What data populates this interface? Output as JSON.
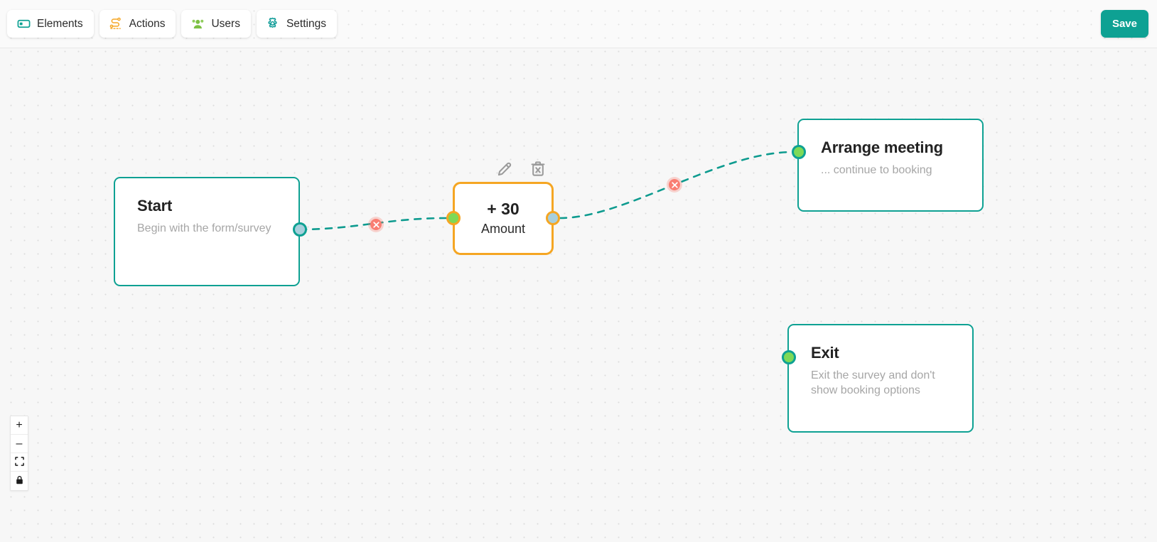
{
  "toolbar": {
    "buttons": [
      {
        "label": "Elements",
        "icon": "elements-icon",
        "color": "#0ea193"
      },
      {
        "label": "Actions",
        "icon": "actions-flow-icon",
        "color": "#f5a623"
      },
      {
        "label": "Users",
        "icon": "users-group-icon",
        "color": "#7cc043"
      },
      {
        "label": "Settings",
        "icon": "gear-icon",
        "color": "#0e9b97"
      }
    ],
    "save_label": "Save",
    "save_color": "#0ea193"
  },
  "canvas": {
    "background_color": "#f7f7f7",
    "dot_color": "#dcdcdc",
    "edge_color": "#0e9b8f",
    "edge_style": "dashed"
  },
  "nodes": [
    {
      "id": "start",
      "title": "Start",
      "description": "Begin with the form/survey",
      "border_color": "#0ea193",
      "selected": false
    },
    {
      "id": "amount",
      "title": "+ 30",
      "description": "Amount",
      "border_color": "#f5a623",
      "selected": true
    },
    {
      "id": "meeting",
      "title": "Arrange meeting",
      "description": "... continue to booking",
      "border_color": "#0ea193",
      "selected": false
    },
    {
      "id": "exit",
      "title": "Exit",
      "description": "Exit the survey and don't show booking options",
      "border_color": "#0ea193",
      "selected": false
    }
  ],
  "node_actions": {
    "edit_icon": "pencil-icon",
    "delete_icon": "trash-x-icon"
  },
  "edge_controls": {
    "delete_icon": "close-x-icon",
    "color": "#f97d72"
  },
  "view_controls": [
    {
      "name": "zoom-in",
      "glyph": "+"
    },
    {
      "name": "zoom-out",
      "glyph": "–"
    },
    {
      "name": "fit-view",
      "glyph": "fit-icon"
    },
    {
      "name": "toggle-lock",
      "glyph": "lock-icon"
    }
  ]
}
